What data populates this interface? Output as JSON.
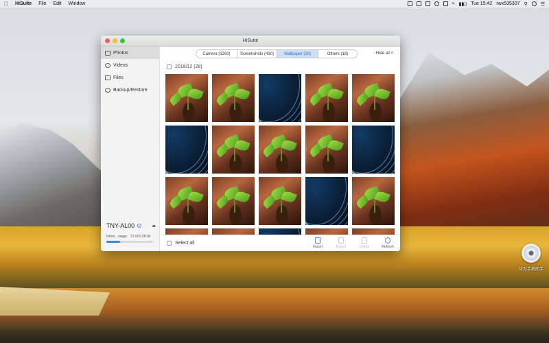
{
  "menubar": {
    "app_name": "HiSuite",
    "menus": [
      "File",
      "Edit",
      "Window"
    ],
    "clock": "Tue 15:42",
    "user": "rwx535307"
  },
  "window": {
    "title": "HiSuite"
  },
  "sidebar": {
    "items": [
      {
        "label": "Photos",
        "icon": "photo-icon"
      },
      {
        "label": "Videos",
        "icon": "video-icon"
      },
      {
        "label": "Files",
        "icon": "folder-icon"
      },
      {
        "label": "Backup/Restore",
        "icon": "backup-icon"
      }
    ],
    "device": {
      "name": "TNY-AL00",
      "storage_label": "Intern...orage:",
      "storage_value": "37.00/128.00",
      "storage_fraction": 0.29
    }
  },
  "tabs": [
    {
      "label": "Camera (1260)"
    },
    {
      "label": "Screenshots (410)"
    },
    {
      "label": "Wallpaper (28)"
    },
    {
      "label": "Others (18)"
    }
  ],
  "hide_all": "Hide all",
  "date_group": "2018/12 (28)",
  "footer": {
    "select_all": "Select all",
    "actions": [
      {
        "label": "Import",
        "enabled": true
      },
      {
        "label": "Export",
        "enabled": false
      },
      {
        "label": "Delete",
        "enabled": false
      },
      {
        "label": "Refresh",
        "enabled": true
      }
    ]
  },
  "desktop_icon": {
    "label": "华为手机助手"
  }
}
